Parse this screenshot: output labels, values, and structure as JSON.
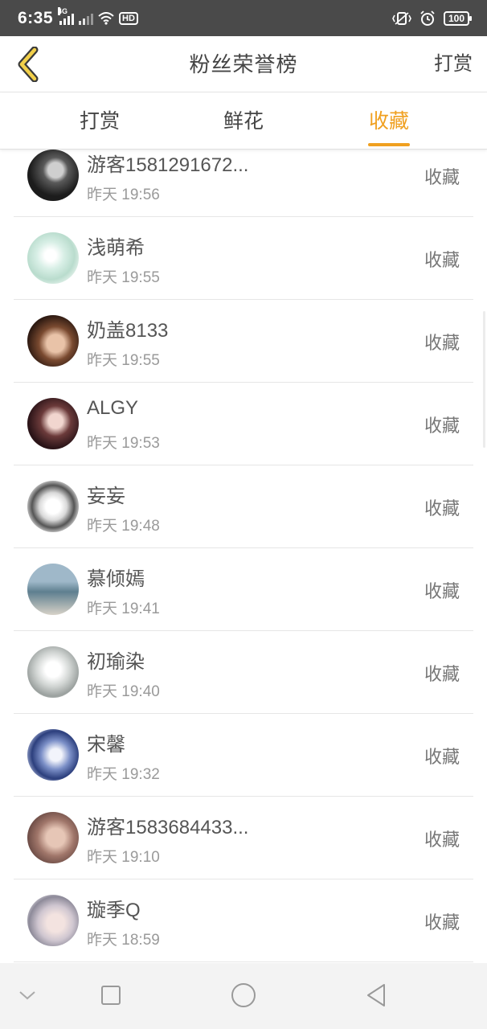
{
  "status_bar": {
    "time": "6:35",
    "network_label": "4G",
    "hd_label": "HD",
    "battery": "100"
  },
  "header": {
    "title": "粉丝荣誉榜",
    "action_label": "打赏"
  },
  "tabs": [
    {
      "label": "打赏",
      "active": false
    },
    {
      "label": "鲜花",
      "active": false
    },
    {
      "label": "收藏",
      "active": true
    }
  ],
  "colors": {
    "accent": "#f0a020",
    "status_bar_bg": "#4a4a4a"
  },
  "list": [
    {
      "name": "游客1581291672...",
      "time": "昨天 19:56",
      "action": "收藏",
      "avatar_icon": "avatar-dark-portrait"
    },
    {
      "name": "浅萌希",
      "time": "昨天 19:55",
      "action": "收藏",
      "avatar_icon": "avatar-anime-girl-mint"
    },
    {
      "name": "奶盖8133",
      "time": "昨天 19:55",
      "action": "收藏",
      "avatar_icon": "avatar-girl-portrait"
    },
    {
      "name": "ALGY",
      "time": "昨天 19:53",
      "action": "收藏",
      "avatar_icon": "avatar-girl-dark-hair"
    },
    {
      "name": "妄妄",
      "time": "昨天 19:48",
      "action": "收藏",
      "avatar_icon": "avatar-anime-monochrome"
    },
    {
      "name": "慕倾嫣",
      "time": "昨天 19:41",
      "action": "收藏",
      "avatar_icon": "avatar-girl-seaside"
    },
    {
      "name": "初瑜染",
      "time": "昨天 19:40",
      "action": "收藏",
      "avatar_icon": "avatar-crown-logo"
    },
    {
      "name": "宋馨",
      "time": "昨天 19:32",
      "action": "收藏",
      "avatar_icon": "avatar-anime-blue-flowers"
    },
    {
      "name": "游客1583684433...",
      "time": "昨天 19:10",
      "action": "收藏",
      "avatar_icon": "avatar-hands-face"
    },
    {
      "name": "璇季Q",
      "time": "昨天 18:59",
      "action": "收藏",
      "avatar_icon": "avatar-anime-boy"
    }
  ],
  "navbar": {
    "items": [
      "chevron-down-icon",
      "square-icon",
      "circle-icon",
      "triangle-back-icon"
    ]
  }
}
